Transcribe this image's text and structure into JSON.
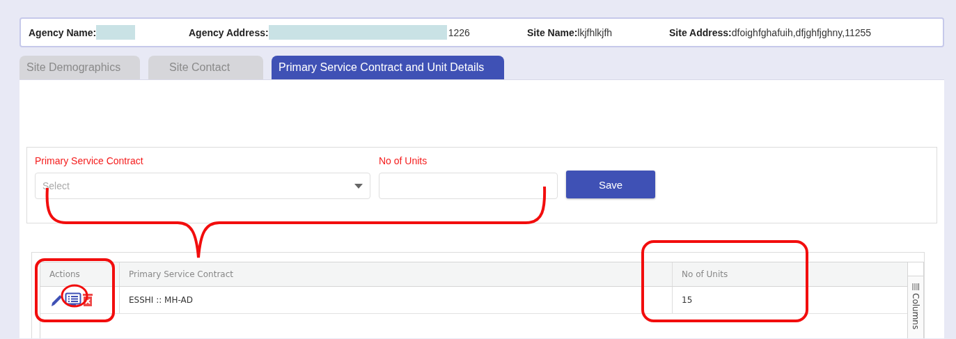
{
  "header": {
    "fields": [
      {
        "label": "Agency Name:",
        "redacted": true
      },
      {
        "label": "Agency Address:",
        "value": "1226",
        "redacted": true
      },
      {
        "label": "Site Name:",
        "value": "lkjfhlkjfh",
        "redacted": false
      },
      {
        "label": "Site Address:",
        "value": "dfoighfghafuih,dfjghfjghny,11255",
        "redacted": false
      }
    ]
  },
  "tabs": [
    {
      "label": "Site Demographics",
      "selected": false
    },
    {
      "label": "Site Contact",
      "selected": false
    },
    {
      "label": "Primary Service Contract and Unit Details",
      "selected": true
    }
  ],
  "form": {
    "fields": [
      {
        "kind": "select",
        "label": "Primary Service Contract",
        "placeholder": "Select"
      },
      {
        "kind": "input",
        "label": "No of Units"
      }
    ],
    "buttons": [
      "Save"
    ]
  },
  "grid": {
    "columns": [
      "Actions",
      "Primary Service Contract",
      "No of Units"
    ],
    "rows": [
      {
        "cells": [
          "",
          "ESSHI :: MH-AD",
          "15"
        ]
      }
    ],
    "side_panel": "Columns"
  }
}
